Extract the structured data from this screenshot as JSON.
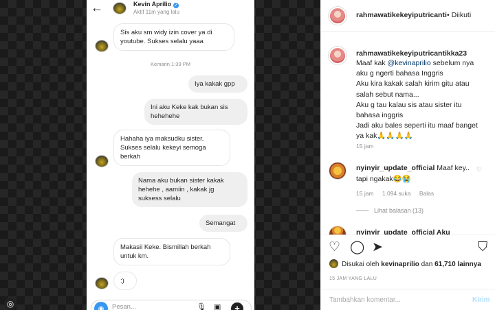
{
  "chat": {
    "contact_name": "Kevin Aprilio",
    "status": "Aktif 11m yang lalu",
    "timestamp": "Kemarin 1:39 PM",
    "messages": [
      {
        "side": "in",
        "text": "Sis aku sm widy izin cover ya di\nyoutube. Sukses selalu yaaa"
      },
      {
        "side": "out",
        "text": "Iya kakak gpp"
      },
      {
        "side": "out",
        "text": "Ini aku Keke kak bukan sis\nhehehehe"
      },
      {
        "side": "in",
        "text": "Hahaha iya maksudku sister.\nSukses selalu kekeyi semoga\nberkah"
      },
      {
        "side": "out",
        "text": "Nama aku  bukan sister kakak\nhehehe , aamiin , kakak jg\nsuksess selalu"
      },
      {
        "side": "out",
        "text": "Semangat"
      },
      {
        "side": "in",
        "text": "Makasii Keke. Bismillah berkah\nuntuk km."
      },
      {
        "side": "in",
        "text": ":)"
      }
    ],
    "composer_placeholder": "Pesan..."
  },
  "post": {
    "username": "rahmawatikekeyiputricanti",
    "follow_status": "• Diikuti",
    "caption_username": "rahmawatikekeyiputricantikka23",
    "caption_mention": "@kevinaprilio",
    "caption_before": "Maaf kak ",
    "caption_after": " sebelum nya\naku g ngerti bahasa Inggris\nAku kira kakak salah kirim gitu atau\nsalah sebut nama...\nAku g tau kalau sis atau sister itu\nbahasa inggris\nJadi aku bales seperti itu maaf banget\nya kak🙏🙏🙏🙏",
    "caption_age": "15 jam",
    "comment": {
      "username": "nyinyir_update_official",
      "text": " Maaf key.. tapi ngakak😂😭",
      "age": "15 jam",
      "likes": "1.094 suka",
      "reply": "Balas",
      "view_replies": "Lihat balasan (13)"
    },
    "partial_comment": "nyinyir_update_official Aku",
    "liked_by_prefix": "Disukai oleh ",
    "liked_by_user": "kevinaprilio",
    "liked_by_middle": " dan ",
    "liked_by_count": "61,710 lainnya",
    "post_age": "15 JAM YANG LALU",
    "add_comment_placeholder": "Tambahkan komentar...",
    "post_button": "Kirim"
  },
  "icons": {
    "back": "back-arrow-icon",
    "verified": "verified-badge-icon",
    "camera": "camera-icon",
    "mic": "microphone-icon",
    "gallery": "gallery-icon",
    "add": "plus-icon",
    "like": "heart-icon",
    "comment": "comment-icon",
    "share": "send-icon",
    "save": "bookmark-icon"
  },
  "colors": {
    "accent": "#3897f0",
    "mention": "#00376b",
    "muted": "#8e8e8e"
  }
}
